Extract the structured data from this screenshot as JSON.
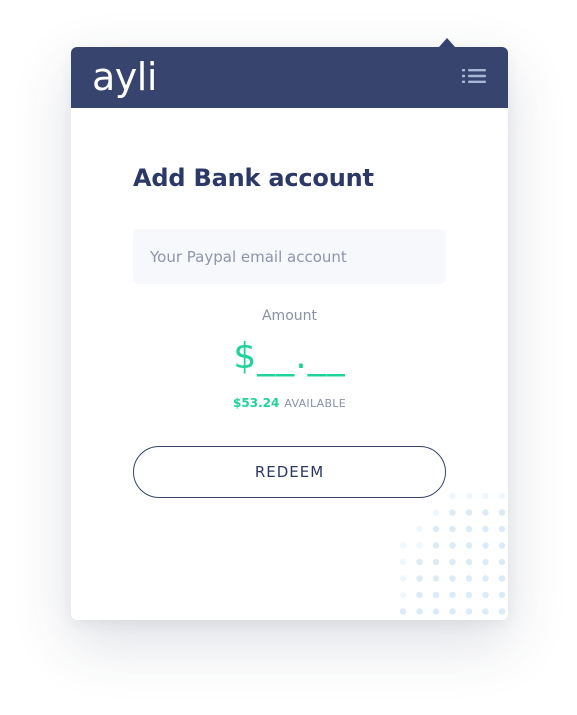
{
  "header": {
    "logo_text": "ayli",
    "menu_icon": "list-menu-icon",
    "background_color": "#36446e"
  },
  "form": {
    "title": "Add Bank account",
    "email_placeholder": "Your Paypal email account",
    "email_value": "",
    "amount_label": "Amount",
    "amount_display": "$__.__",
    "available_amount": "$53.24",
    "available_label": "AVAILABLE",
    "redeem_label": "REDEEM"
  },
  "colors": {
    "accent_green": "#1fd39a",
    "navy": "#36446e",
    "title_text": "#2c3866",
    "muted_text": "#8a91a7",
    "input_background": "#f7f8fb",
    "dot_pattern": "#dcebf8"
  }
}
